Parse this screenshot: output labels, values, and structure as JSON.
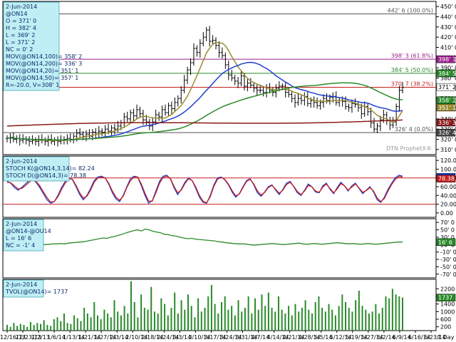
{
  "chart_data": [
    {
      "type": "ohlc",
      "info": {
        "date": "2-Jun-2014",
        "symbol": "@ON14",
        "open": "O = 371' 0",
        "high": "H = 382' 4",
        "low": "L = 369' 2",
        "last": "L = 371' 2",
        "change": "NC = 0' 2",
        "mov100": "MOV(@ON14,100)= 358' 2",
        "mov200": "MOV(@ON14,200)= 336' 3",
        "mov20": "MOV(@ON14,20)= 351' 1",
        "mov50": "MOV(@ON14,50)= 357' 1",
        "footer": "R=-20.0, V=308' 1"
      },
      "fib_levels": [
        {
          "label": "442' 6 (100.0%)",
          "value": 442.75,
          "color": "#555555"
        },
        {
          "label": "398' 3 (61.8%)",
          "value": 398.4,
          "color": "#9b1f8a"
        },
        {
          "label": "384' 5 (50.0%)",
          "value": 384.6,
          "color": "#2a8a2a"
        },
        {
          "label": "370' 7 (38.2%)",
          "value": 370.9,
          "color": "#c41e1e"
        },
        {
          "label": "326' 4 (0.0%)",
          "value": 326.5,
          "color": "#555555"
        }
      ],
      "y_ticks": [
        "450' 0",
        "440' 0",
        "430' 0",
        "420' 0",
        "410' 0",
        "400' 0",
        "390' 0",
        "380' 0",
        "370' 0",
        "360' 0",
        "350' 0",
        "340' 0",
        "330' 0",
        "320' 0",
        "310' 0"
      ],
      "y_tick_values": [
        450,
        440,
        430,
        420,
        410,
        400,
        390,
        380,
        370,
        360,
        350,
        340,
        330,
        320,
        310
      ],
      "ylim": [
        305,
        455
      ],
      "badges": [
        {
          "text": "398' 3",
          "value": 398.4,
          "bg": "#9b1f8a",
          "fg": "#ffffff"
        },
        {
          "text": "384' 5",
          "value": 384.6,
          "bg": "#2a8a2a",
          "fg": "#ffffff"
        },
        {
          "text": "371' 2",
          "value": 371.2,
          "bg": "#ffffff",
          "fg": "#000000"
        },
        {
          "text": "358' 2",
          "value": 358.2,
          "bg": "#2a8a2a",
          "fg": "#ffffff"
        },
        {
          "text": "351' 1",
          "value": 351.1,
          "bg": "#9a8c30",
          "fg": "#ffffff"
        },
        {
          "text": "336' 3",
          "value": 336.4,
          "bg": "#8b1a1a",
          "fg": "#ffffff"
        },
        {
          "text": "326' 4",
          "value": 326.5,
          "bg": "#444444",
          "fg": "#ffffff"
        }
      ],
      "watermark": "DTN ProphetX®",
      "ohlc_close": [
        321,
        322,
        320,
        321,
        319,
        320,
        319,
        318,
        319,
        318,
        320,
        319,
        318,
        320,
        318,
        319,
        318,
        319,
        320,
        321,
        320,
        323,
        326,
        325,
        323,
        325,
        323,
        327,
        325,
        328,
        327,
        330,
        328,
        331,
        330,
        333,
        336,
        342,
        340,
        346,
        343,
        349,
        345,
        339,
        337,
        333,
        337,
        344,
        342,
        349,
        346,
        353,
        350,
        356,
        360,
        368,
        378,
        388,
        395,
        409,
        405,
        414,
        420,
        427,
        416,
        417,
        412,
        405,
        402,
        393,
        383,
        380,
        377,
        375,
        382,
        372,
        375,
        373,
        370,
        368,
        368,
        366,
        370,
        368,
        366,
        370,
        372,
        372,
        366,
        364,
        360,
        356,
        360,
        358,
        362,
        355,
        358,
        356,
        353,
        356,
        360,
        358,
        361,
        362,
        356,
        358,
        357,
        352,
        351,
        355,
        354,
        351,
        345,
        352,
        347,
        336,
        330,
        333,
        339,
        344,
        338,
        334,
        337,
        352,
        368,
        371
      ]
    },
    {
      "type": "line",
      "info": {
        "date": "2-Jun-2014",
        "k": "STOCH K(@ON14,3,14)= 82.24",
        "d": "STOCH D(@ON14,3)= 78.38"
      },
      "y_ticks": [
        "120.00",
        "100.00",
        "80.00",
        "60.00",
        "40.00",
        "20.00",
        "0.00"
      ],
      "y_tick_values": [
        120,
        100,
        80,
        60,
        40,
        20,
        0
      ],
      "ylim": [
        -10,
        130
      ],
      "reference_lines": [
        {
          "value": 80,
          "color": "#c41e1e"
        },
        {
          "value": 20,
          "color": "#c41e1e"
        }
      ],
      "badges": [
        {
          "text": "82.24",
          "value": 82.24,
          "bg": "#1f3fcf",
          "fg": "#ffffff"
        },
        {
          "text": "78.38",
          "value": 78.38,
          "bg": "#c41e1e",
          "fg": "#ffffff"
        }
      ],
      "series": [
        {
          "name": "STOCH K",
          "color": "#1f3fcf",
          "values": [
            72,
            68,
            58,
            52,
            58,
            66,
            74,
            78,
            70,
            58,
            44,
            30,
            22,
            26,
            40,
            58,
            72,
            80,
            76,
            60,
            42,
            30,
            40,
            56,
            74,
            82,
            84,
            80,
            66,
            46,
            32,
            26,
            40,
            60,
            78,
            84,
            82,
            62,
            40,
            22,
            28,
            50,
            72,
            84,
            86,
            78,
            58,
            42,
            54,
            70,
            80,
            74,
            56,
            36,
            24,
            22,
            40,
            64,
            80,
            82,
            76,
            64,
            48,
            36,
            44,
            60,
            74,
            78,
            64,
            46,
            38,
            48,
            60,
            64,
            52,
            42,
            54,
            68,
            72,
            60,
            46,
            40,
            52,
            66,
            60,
            48,
            46,
            62,
            68,
            54,
            44,
            58,
            70,
            62,
            50,
            62,
            68,
            56,
            44,
            52,
            60,
            48,
            30,
            24,
            36,
            54,
            68,
            80,
            86,
            84
          ]
        },
        {
          "name": "STOCH D",
          "color": "#c41e1e",
          "values": [
            70,
            69,
            62,
            55,
            56,
            62,
            70,
            76,
            72,
            62,
            48,
            35,
            25,
            26,
            37,
            54,
            68,
            78,
            77,
            63,
            46,
            34,
            38,
            52,
            70,
            80,
            82,
            80,
            68,
            50,
            36,
            29,
            38,
            58,
            74,
            82,
            82,
            66,
            45,
            27,
            27,
            46,
            68,
            81,
            84,
            79,
            61,
            46,
            52,
            67,
            78,
            74,
            59,
            40,
            27,
            23,
            37,
            61,
            77,
            81,
            77,
            66,
            51,
            39,
            43,
            58,
            72,
            77,
            66,
            50,
            41,
            47,
            58,
            63,
            54,
            45,
            52,
            65,
            70,
            61,
            49,
            42,
            50,
            63,
            60,
            50,
            47,
            59,
            66,
            56,
            46,
            55,
            67,
            62,
            52,
            59,
            66,
            57,
            47,
            51,
            58,
            50,
            34,
            26,
            33,
            50,
            65,
            77,
            83,
            82
          ]
        }
      ]
    },
    {
      "type": "line",
      "info": {
        "date": "2-Jun-2014",
        "symbol": "@ON14-@OU14",
        "last": "L = 16' 6",
        "change": "NC = -1' 4"
      },
      "y_ticks": [
        "70' 0",
        "50' 0",
        "30' 0",
        "10' 0",
        "-10' 0",
        "-30' 0",
        "-50' 0",
        "-70' 0"
      ],
      "y_tick_values": [
        70,
        50,
        30,
        10,
        -10,
        -30,
        -50,
        -70
      ],
      "ylim": [
        -80,
        80
      ],
      "badges": [
        {
          "text": "16' 6",
          "value": 16.75,
          "bg": "#2a8a2a",
          "fg": "#ffffff"
        }
      ],
      "series": [
        {
          "name": "",
          "color": "#2a8a2a",
          "values": [
            8,
            9,
            8,
            9,
            8,
            9,
            10,
            9,
            10,
            11,
            10,
            11,
            12,
            12,
            13,
            12,
            14,
            15,
            16,
            17,
            18,
            20,
            22,
            24,
            26,
            28,
            27,
            30,
            32,
            35,
            38,
            42,
            45,
            48,
            50,
            47,
            52,
            50,
            46,
            44,
            42,
            38,
            37,
            34,
            33,
            30,
            28,
            26,
            27,
            25,
            24,
            23,
            22,
            21,
            20,
            18,
            17,
            15,
            14,
            13,
            12,
            12,
            12,
            10,
            9,
            9,
            10,
            11,
            12,
            13,
            12,
            11,
            10,
            11,
            12,
            13,
            14,
            12,
            11,
            12,
            13,
            12,
            11,
            12,
            13,
            14,
            15,
            14,
            13,
            12,
            13,
            12,
            11,
            12,
            13,
            12,
            11,
            12,
            13,
            14,
            15,
            16,
            17,
            17
          ]
        }
      ]
    },
    {
      "type": "bar",
      "info": {
        "date": "2-Jun-2014",
        "volume": "TVOL(@ON14)= 1737"
      },
      "y_ticks": [
        "2200",
        "1800",
        "1400",
        "1000",
        "600",
        "200"
      ],
      "y_tick_values": [
        2200,
        1800,
        1400,
        1000,
        600,
        200
      ],
      "ylim": [
        0,
        2700
      ],
      "badges": [
        {
          "text": "1737",
          "value": 1737,
          "bg": "#2a8a2a",
          "fg": "#ffffff"
        }
      ],
      "values": [
        300,
        200,
        400,
        250,
        350,
        300,
        200,
        450,
        300,
        400,
        350,
        550,
        300,
        250,
        600,
        700,
        500,
        900,
        400,
        350,
        800,
        650,
        500,
        1200,
        900,
        700,
        1500,
        800,
        600,
        1100,
        900,
        700,
        1600,
        1000,
        800,
        1300,
        900,
        2600,
        1500,
        700,
        1900,
        1200,
        1100,
        2300,
        1000,
        900,
        1700,
        1400,
        800,
        1200,
        2000,
        900,
        1600,
        1100,
        1900,
        1300,
        700,
        1700,
        1000,
        1200,
        1800,
        2400,
        1400,
        900,
        1500,
        1800,
        1100,
        1300,
        800,
        1600,
        1000,
        1200,
        1800,
        900,
        1700,
        1100,
        1900,
        1300,
        2000,
        1200,
        1000,
        1800,
        1100,
        900,
        1300,
        800,
        1400,
        1000,
        1200,
        1600,
        1100,
        900,
        1500,
        1800,
        1200,
        1000,
        1400,
        1100,
        800,
        1300,
        1900,
        1500,
        1200,
        1000,
        1600,
        2100,
        1300,
        1100,
        900,
        1000,
        1400,
        900,
        1200,
        1800,
        1700,
        2200,
        1900,
        1800,
        1737
      ]
    }
  ],
  "x_labels": [
    "12/16/13",
    "12/23/13",
    "1/2/13",
    "1/6/14",
    "1/13/14",
    "1/21/14",
    "1/27/14",
    "2/3/14",
    "2/10/14",
    "2/18/14",
    "2/24/14",
    "3/3/14",
    "3/10/14",
    "3/17/14",
    "3/24/14",
    "3/31/14",
    "4/7/14",
    "4/14/14",
    "4/21/14",
    "4/28/14",
    "5/5/14",
    "5/12/14",
    "5/19/14",
    "5/27/14",
    "6/2/14",
    "6/9/14",
    "6/16/14",
    "6/23/14"
  ],
  "timeframe": "1 Day"
}
